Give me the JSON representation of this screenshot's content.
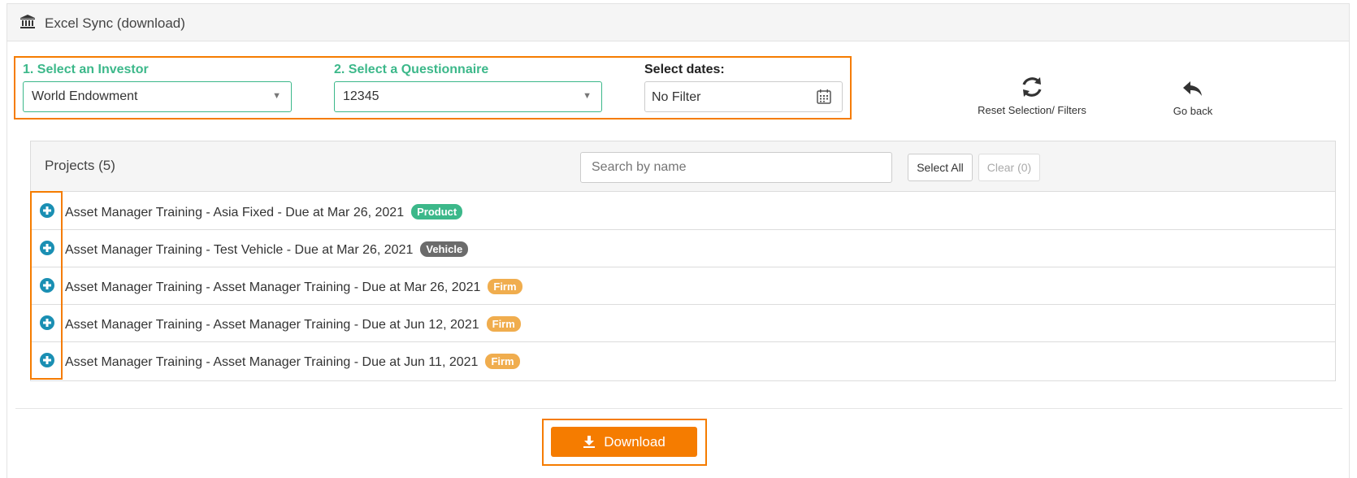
{
  "header": {
    "title": "Excel Sync (download)",
    "icon": "bank-icon"
  },
  "filters": {
    "investor_label": "1. Select an Investor",
    "investor_value": "World Endowment",
    "questionnaire_label": "2. Select a Questionnaire",
    "questionnaire_value": "12345",
    "dates_label": "Select dates:",
    "dates_value": "No Filter"
  },
  "actions": {
    "reset_label": "Reset Selection/ Filters",
    "back_label": "Go back"
  },
  "projects": {
    "title": "Projects (5)",
    "search_placeholder": "Search by name",
    "select_all_label": "Select All",
    "clear_label": "Clear (0)",
    "items": [
      {
        "text": "Asset Manager Training - Asia Fixed - Due at Mar 26, 2021",
        "badge": "Product",
        "badge_color": "#3cb88a"
      },
      {
        "text": "Asset Manager Training - Test Vehicle - Due at Mar 26, 2021",
        "badge": "Vehicle",
        "badge_color": "#6b6b6b"
      },
      {
        "text": "Asset Manager Training - Asset Manager Training - Due at Mar 26, 2021",
        "badge": "Firm",
        "badge_color": "#f0ad4e"
      },
      {
        "text": "Asset Manager Training - Asset Manager Training - Due at Jun 12, 2021",
        "badge": "Firm",
        "badge_color": "#f0ad4e"
      },
      {
        "text": "Asset Manager Training - Asset Manager Training - Due at Jun 11, 2021",
        "badge": "Firm",
        "badge_color": "#f0ad4e"
      }
    ]
  },
  "download": {
    "label": "Download"
  },
  "colors": {
    "accent": "#f57c00",
    "green": "#3cb88a",
    "plus_icon": "#1a8fb3"
  }
}
